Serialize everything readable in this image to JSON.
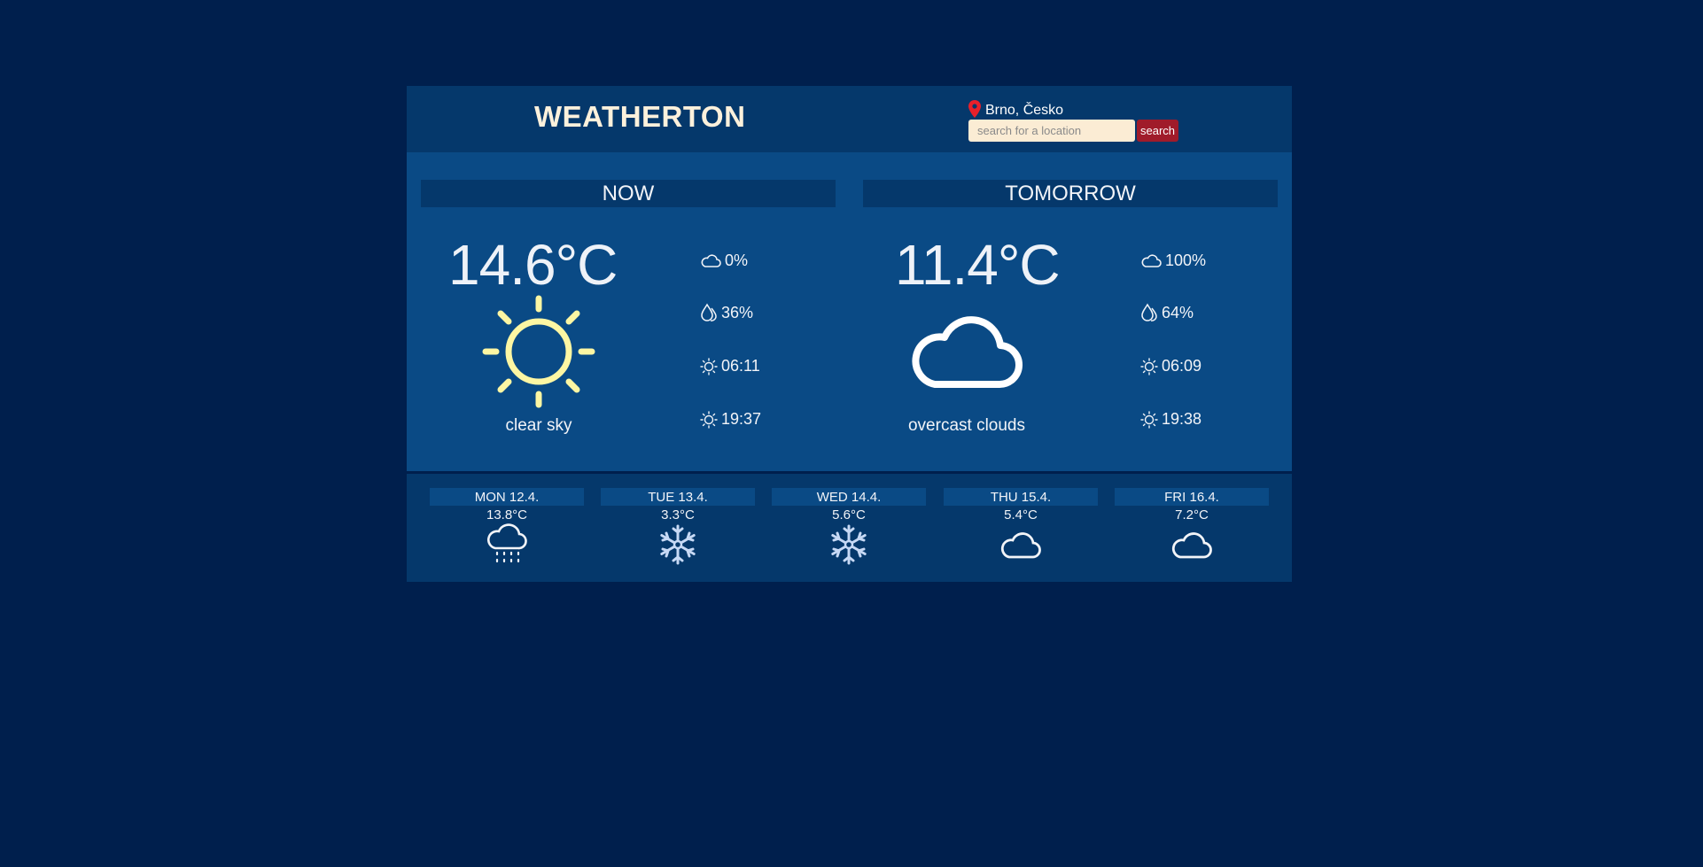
{
  "header": {
    "title": "WEATHERTON",
    "location": "Brno, Česko",
    "search_placeholder": "search for a location",
    "search_label": "search"
  },
  "now": {
    "heading": "NOW",
    "temperature": "14.6°C",
    "description": "clear sky",
    "icon": "sun-icon",
    "clouds": "0%",
    "humidity": "36%",
    "sunrise": "06:11",
    "sunset": "19:37"
  },
  "tomorrow": {
    "heading": "TOMORROW",
    "temperature": "11.4°C",
    "description": "overcast clouds",
    "icon": "cloud-icon",
    "clouds": "100%",
    "humidity": "64%",
    "sunrise": "06:09",
    "sunset": "19:38"
  },
  "forecast": [
    {
      "day": "MON 12.4.",
      "temp": "13.8°C",
      "icon": "rain-icon"
    },
    {
      "day": "TUE 13.4.",
      "temp": "3.3°C",
      "icon": "snowflake-icon"
    },
    {
      "day": "WED 14.4.",
      "temp": "5.6°C",
      "icon": "snowflake-icon"
    },
    {
      "day": "THU 15.4.",
      "temp": "5.4°C",
      "icon": "cloud-icon"
    },
    {
      "day": "FRI 16.4.",
      "temp": "7.2°C",
      "icon": "cloud-icon"
    }
  ],
  "colors": {
    "page_background": "#001f4d",
    "header_background": "#05386b",
    "main_background": "#0a4a85",
    "title": "#fdf1dc",
    "sun": "#fdf6a3",
    "search_button": "#a01b2a",
    "pin": "#e8202a"
  }
}
